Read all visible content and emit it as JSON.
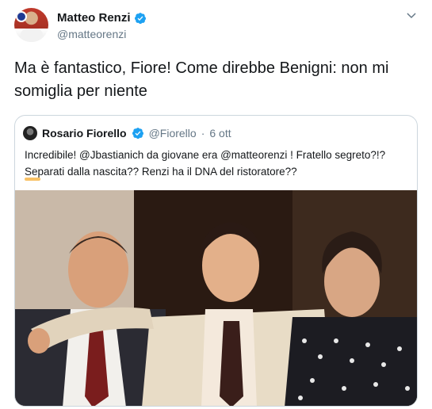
{
  "author": {
    "display_name": "Matteo Renzi",
    "handle": "@matteorenzi"
  },
  "tweet": {
    "text": "Ma è fantastico, Fiore! Come direbbe Benigni: non mi somiglia per niente"
  },
  "quoted": {
    "display_name": "Rosario Fiorello",
    "handle": "@Fiorello",
    "separator": "·",
    "date": "6 ott",
    "text": "Incredibile! @Jbastianich da giovane era @matteorenzi ! Fratello segreto?!? Separati dalla nascita?? Renzi ha il DNA del ristoratore??"
  },
  "colors": {
    "verified": "#1da1f2",
    "secondary_text": "#657786",
    "border": "#ccd6dd"
  },
  "icons": {
    "verified": "verified-badge-icon",
    "menu": "chevron-down-icon"
  }
}
